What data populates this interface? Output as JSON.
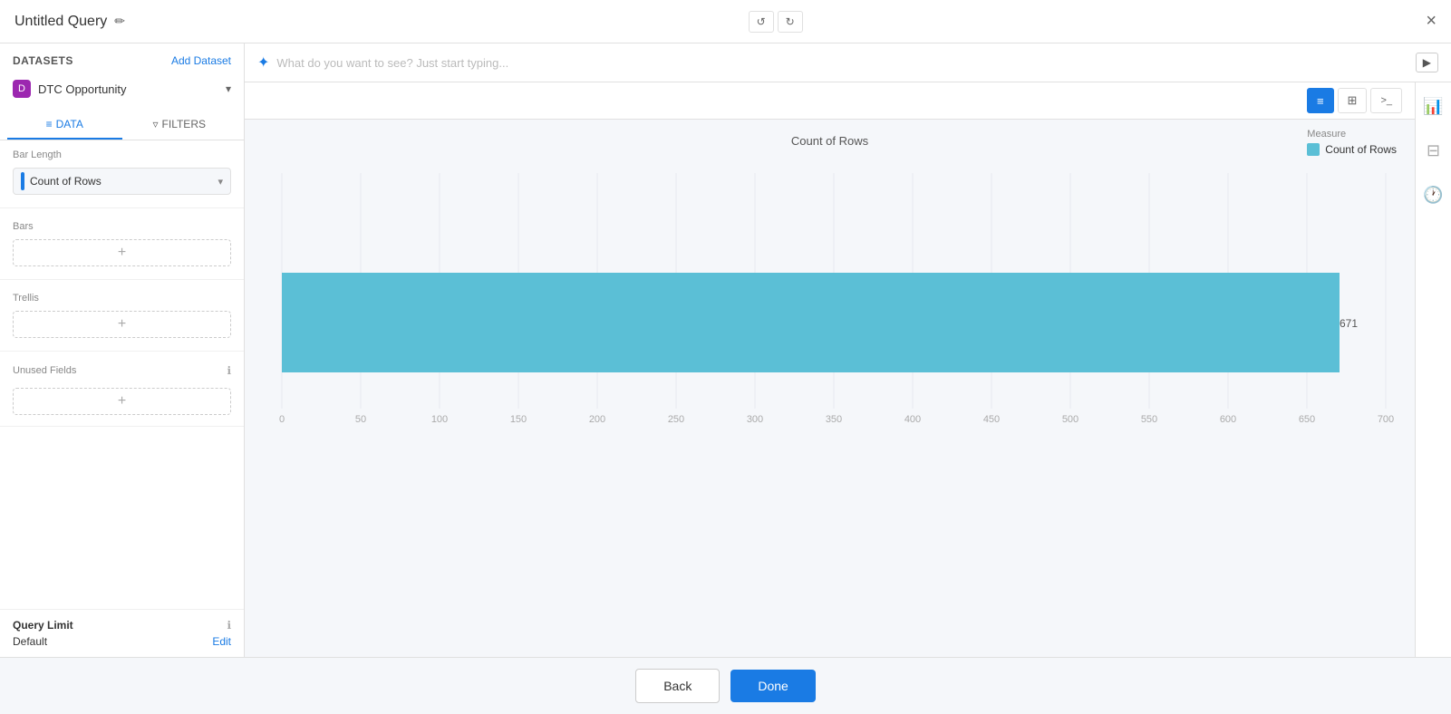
{
  "header": {
    "title": "Untitled Query",
    "close_label": "×",
    "edit_icon": "✏"
  },
  "undo_btn": "↺",
  "redo_btn": "↻",
  "datasets": {
    "label": "Datasets",
    "add_label": "Add Dataset",
    "items": [
      {
        "name": "DTC Opportunity",
        "icon": "D"
      }
    ]
  },
  "tabs": [
    {
      "id": "data",
      "label": "DATA",
      "icon": "≡",
      "active": true
    },
    {
      "id": "filters",
      "label": "FILTERS",
      "icon": "▿",
      "active": false
    }
  ],
  "bar_length": {
    "label": "Bar Length",
    "field": "Count of Rows"
  },
  "bars": {
    "label": "Bars",
    "add_placeholder": "+"
  },
  "trellis": {
    "label": "Trellis",
    "add_placeholder": "+"
  },
  "unused_fields": {
    "label": "Unused Fields",
    "add_placeholder": "+"
  },
  "query_limit": {
    "label": "Query Limit",
    "value": "Default",
    "edit_label": "Edit"
  },
  "query_bar": {
    "placeholder": "What do you want to see? Just start typing...",
    "run_icon": "▶"
  },
  "viz_buttons": [
    {
      "id": "bar",
      "icon": "☰",
      "active": true
    },
    {
      "id": "table",
      "icon": "⊞",
      "active": false
    },
    {
      "id": "code",
      "icon": ">_",
      "active": false
    }
  ],
  "chart": {
    "title": "Count of Rows",
    "bar_value": 671,
    "bar_max": 700,
    "bar_color": "#5bbfd6",
    "x_axis": [
      0,
      50,
      100,
      150,
      200,
      250,
      300,
      350,
      400,
      450,
      500,
      550,
      600,
      650,
      700
    ],
    "legend_title": "Measure",
    "legend_label": "Count of Rows",
    "legend_color": "#5bbfd6"
  },
  "right_icons": [
    {
      "id": "chart-icon",
      "symbol": "📊"
    },
    {
      "id": "filter-icon",
      "symbol": "⊟"
    },
    {
      "id": "clock-icon",
      "symbol": "🕐"
    }
  ],
  "footer": {
    "back_label": "Back",
    "done_label": "Done"
  }
}
